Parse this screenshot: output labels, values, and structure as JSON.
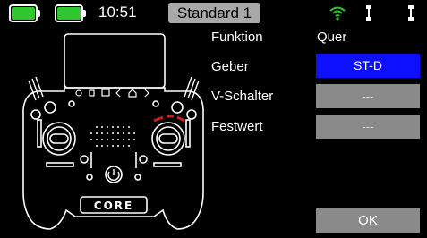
{
  "status": {
    "time": "10:51",
    "model_name": "Standard 1",
    "batteries": [
      "battery-icon",
      "battery-icon"
    ],
    "signal_icon": "wifi-signal-icon",
    "antenna_icons": [
      "antenna-icon",
      "antenna-icon"
    ]
  },
  "transmitter": {
    "logo_text": "CORE"
  },
  "assign": {
    "rows": [
      {
        "label": "Funktion",
        "value": "Quer"
      },
      {
        "label": "Geber",
        "value": "ST-D"
      },
      {
        "label": "V-Schalter",
        "value": "---"
      },
      {
        "label": "Festwert",
        "value": "---"
      }
    ],
    "ok_label": "OK"
  },
  "colors": {
    "active": "#0f0fff",
    "inactive": "#8a8a8a",
    "battery": "#2ec82e",
    "signal": "#2ec82e",
    "highlight_red": "#c81e1e"
  }
}
